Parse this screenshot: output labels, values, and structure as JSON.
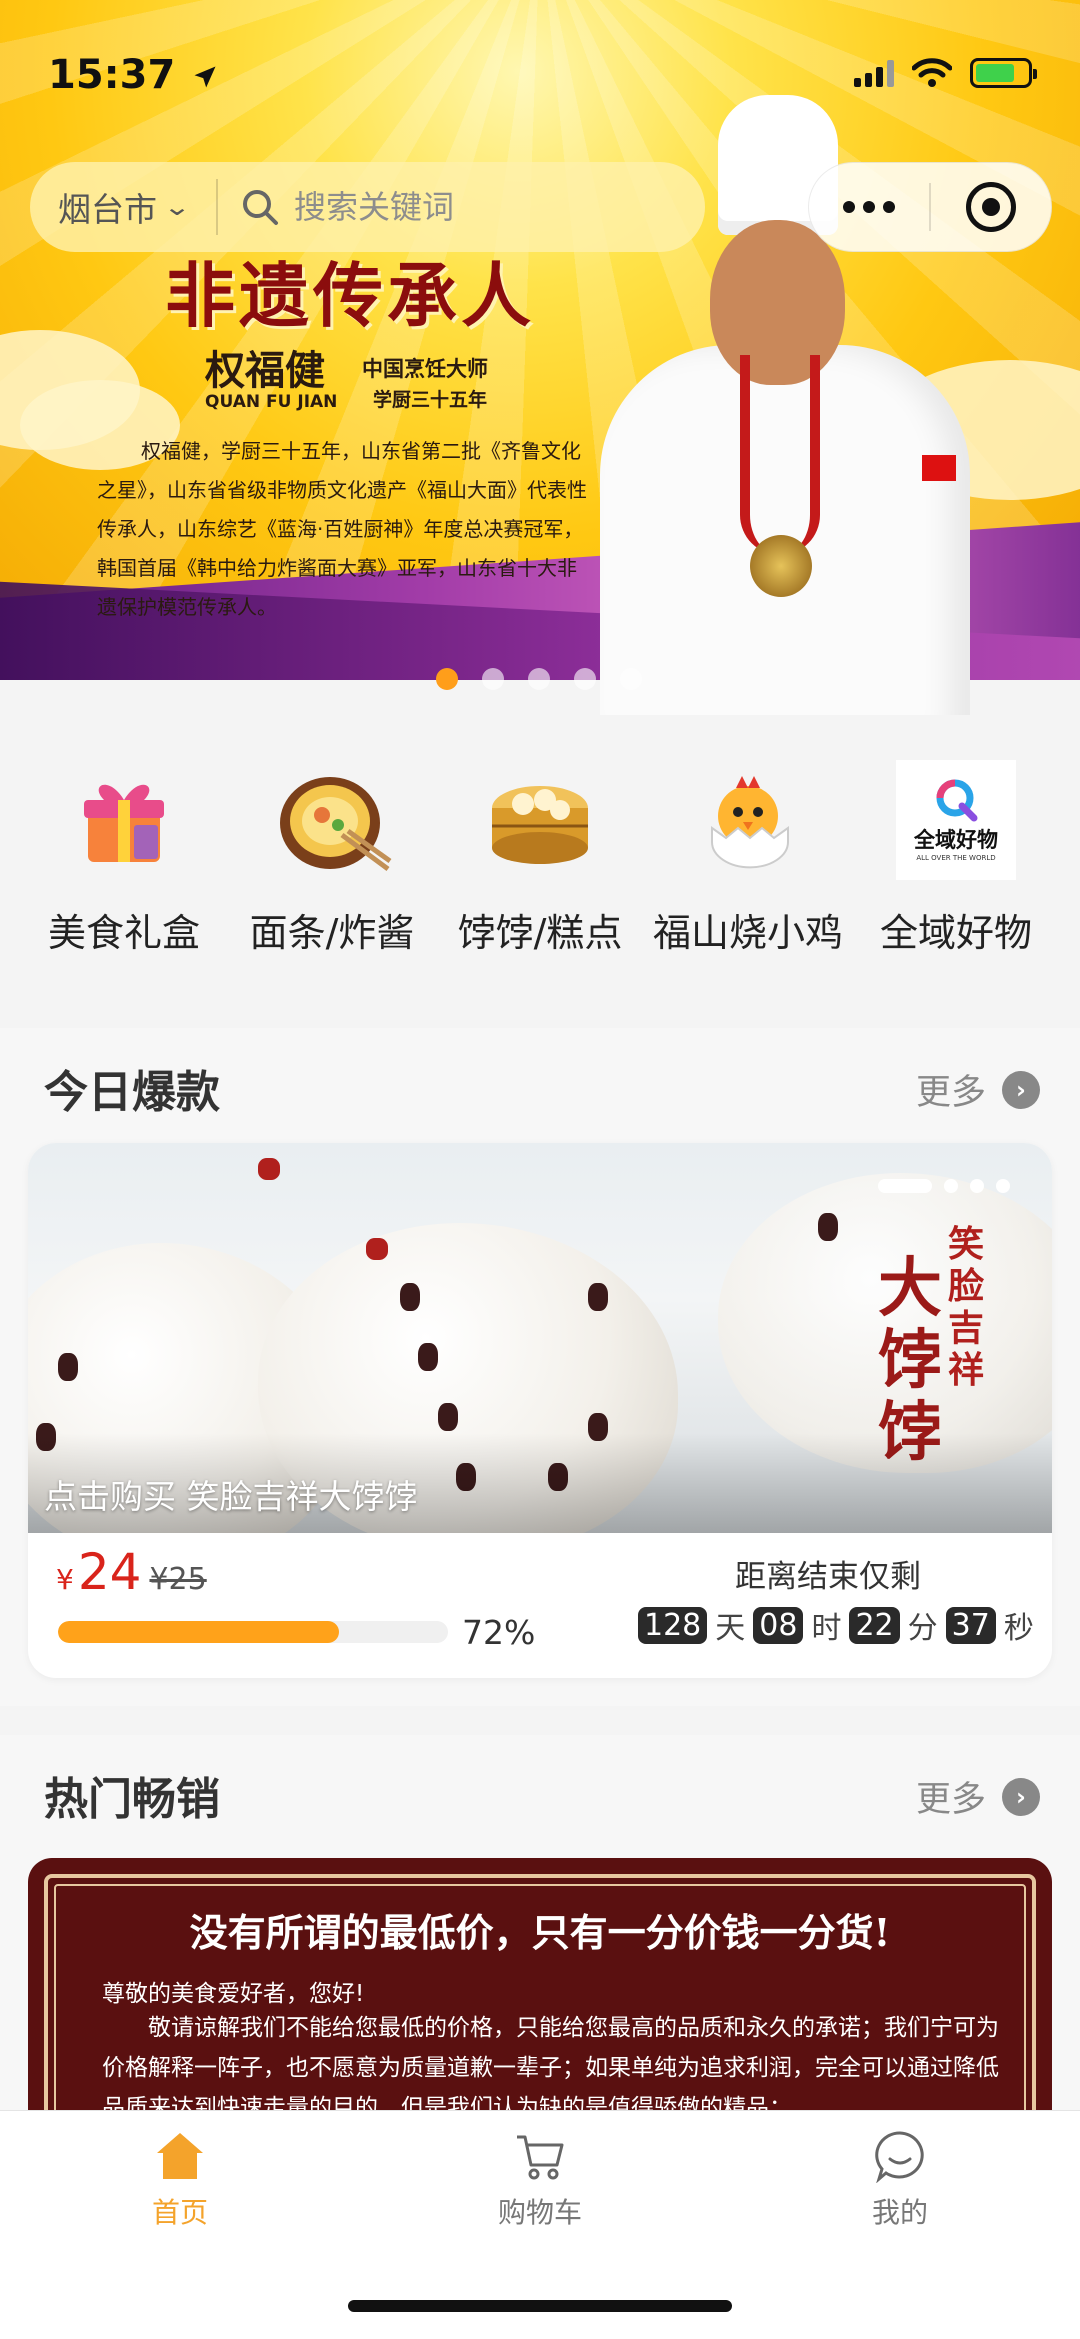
{
  "status": {
    "time": "15:37"
  },
  "search": {
    "city": "烟台市",
    "placeholder": "搜索关键词"
  },
  "banner": {
    "title": "非遗传承人",
    "master_name": "权福健",
    "master_pinyin": "QUAN FU JIAN",
    "master_role": "中国烹饪大师",
    "master_years": "学厨三十五年",
    "description": "权福健，学厨三十五年，山东省第二批《齐鲁文化之星》，山东省省级非物质文化遗产《福山大面》代表性传承人，山东综艺《蓝海·百姓厨神》年度总决赛冠军，韩国首届《韩中给力炸酱面大赛》亚军，山东省十大非遗保护模范传承人。",
    "slide_count": 5,
    "active_slide": 0
  },
  "categories": [
    {
      "label": "美食礼盒",
      "icon": "gift-box-icon"
    },
    {
      "label": "面条/炸酱",
      "icon": "noodle-bowl-icon"
    },
    {
      "label": "饽饽/糕点",
      "icon": "steamer-basket-icon"
    },
    {
      "label": "福山烧小鸡",
      "icon": "chick-icon"
    },
    {
      "label": "全域好物",
      "icon": "quanyu-logo-icon",
      "logo_text": "全域好物",
      "logo_subtext": "ALL OVER THE WORLD"
    }
  ],
  "today_deals": {
    "title": "今日爆款",
    "more": "更多",
    "product": {
      "caption": "点击购买 笑脸吉祥大饽饽",
      "image_text_small": "笑脸吉祥",
      "image_text_big": "大饽饽",
      "currency": "¥",
      "price": "24",
      "original_price": "¥25",
      "sold_percent": 72,
      "sold_percent_label": "72%",
      "countdown_label": "距离结束仅剩",
      "countdown": {
        "days": "128",
        "days_unit": "天",
        "hours": "08",
        "hours_unit": "时",
        "minutes": "22",
        "minutes_unit": "分",
        "seconds": "37",
        "seconds_unit": "秒"
      }
    }
  },
  "hot_sales": {
    "title": "热门畅销",
    "more": "更多",
    "card": {
      "headline": "没有所谓的最低价，只有一分价钱一分货!",
      "greeting": "尊敬的美食爱好者，您好!",
      "body": "敬请谅解我们不能给您最低的价格，只能给您最高的品质和永久的承诺；我们宁可为价格解释一阵子，也不愿意为质量道歉一辈子；如果单纯为追求利润，完全可以通过降低品质来达到快速走量的目的，但是我们认为缺的是值得骄傲的精品；"
    }
  },
  "tabbar": [
    {
      "label": "首页",
      "icon": "home-icon",
      "active": true
    },
    {
      "label": "购物车",
      "icon": "cart-icon",
      "active": false
    },
    {
      "label": "我的",
      "icon": "chat-bubble-icon",
      "active": false
    }
  ],
  "colors": {
    "accent": "#f4a32b",
    "price": "#d9241b",
    "progress": "#ffa21a",
    "banner_yellow": "#ffc812"
  }
}
